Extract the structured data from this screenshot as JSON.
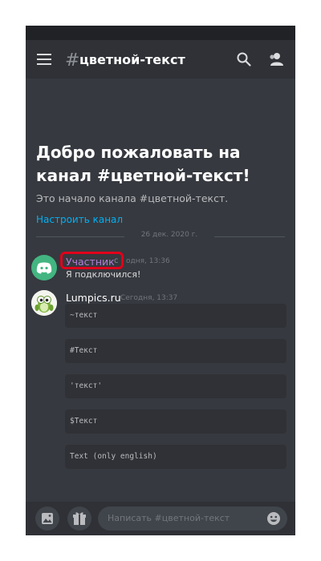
{
  "header": {
    "hash": "#",
    "channel_name": "цветной-текст"
  },
  "welcome": {
    "title": "Добро пожаловать на канал #цветной-текст!",
    "subtitle": "Это начало канала #цветной-текст.",
    "setup_link": "Настроить канал"
  },
  "date_divider": "26 дек. 2020 г.",
  "messages": [
    {
      "author": "Участник",
      "author_tail": "c",
      "timestamp": "одня, 13:36",
      "text": "Я подключился!"
    },
    {
      "author": "Lumpics.ru",
      "timestamp": "Сегодня, 13:37",
      "code_blocks": [
        "~текст",
        "#Текст",
        "'текст'",
        "$Текст",
        "Text (only english)"
      ]
    }
  ],
  "composer": {
    "placeholder": "Написать #цветной-текст"
  },
  "colors": {
    "background": "#36393f",
    "bars": "#2f3136",
    "accent_link": "#00b0f4",
    "role_color": "#b27fd6",
    "highlight_frame": "#e0001b"
  },
  "icons": [
    "menu-icon",
    "search-icon",
    "members-icon",
    "discord-logo-icon",
    "image-icon",
    "gift-icon",
    "emoji-icon"
  ]
}
